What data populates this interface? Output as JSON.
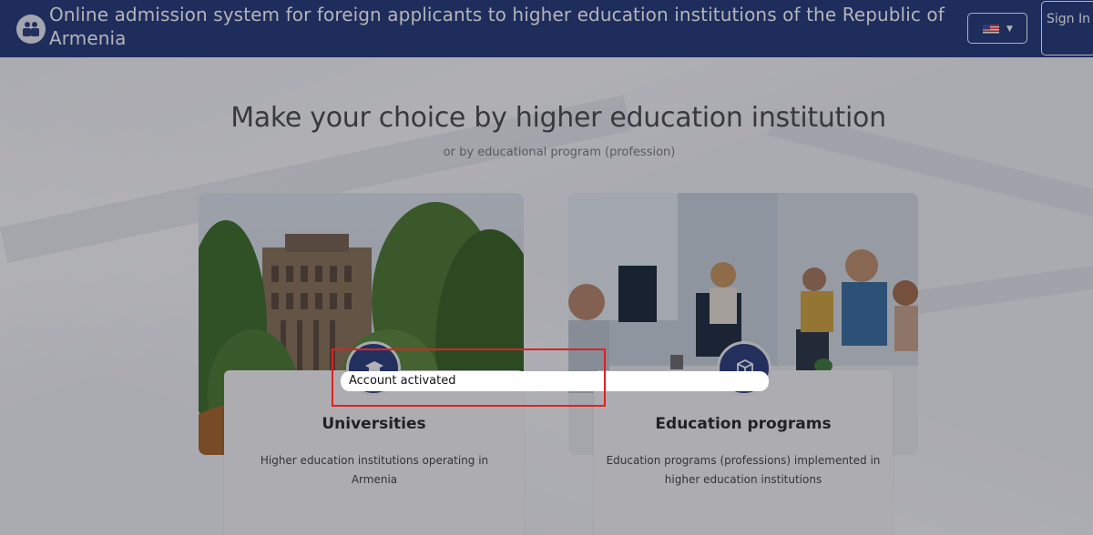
{
  "header": {
    "logo_icon": "people-icon",
    "title": "Online admission system for foreign applicants to higher education institutions of the Republic of Armenia",
    "language_flag": "us-flag-icon",
    "language_caret": "caret-down-icon",
    "signin_label": "Sign In",
    "background_color": "#243a7a"
  },
  "hero": {
    "heading": "Make your choice by higher education institution",
    "subheading": "or by educational program (profession)"
  },
  "cards": [
    {
      "icon": "graduation-cap-icon",
      "title": "Universities",
      "description": "Higher education institutions operating in Armenia"
    },
    {
      "icon": "box-icon",
      "title": "Education programs",
      "description": "Education programs (professions) implemented in higher education institutions"
    }
  ],
  "toast": {
    "message": "Account activated"
  },
  "colors": {
    "accent": "#2c3f7c",
    "highlight_border": "#e02020"
  }
}
